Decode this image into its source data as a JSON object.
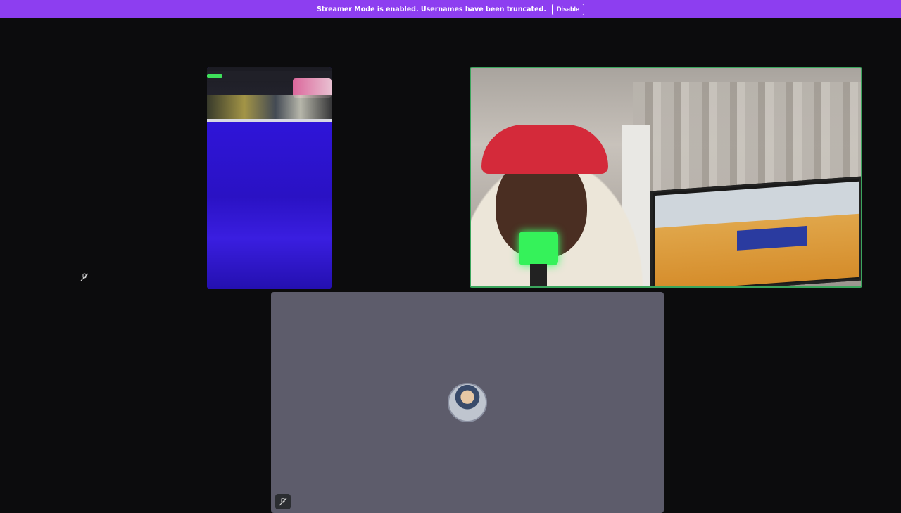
{
  "notice": {
    "message": "Streamer Mode is enabled. Usernames have been truncated.",
    "button_label": "Disable",
    "color": "#8d3ef0"
  },
  "tiles": {
    "speaking_border_color": "#3ba55d",
    "user_tile_bg": "#5d5c6b"
  },
  "icons": {
    "mute": "mic-off-icon"
  }
}
